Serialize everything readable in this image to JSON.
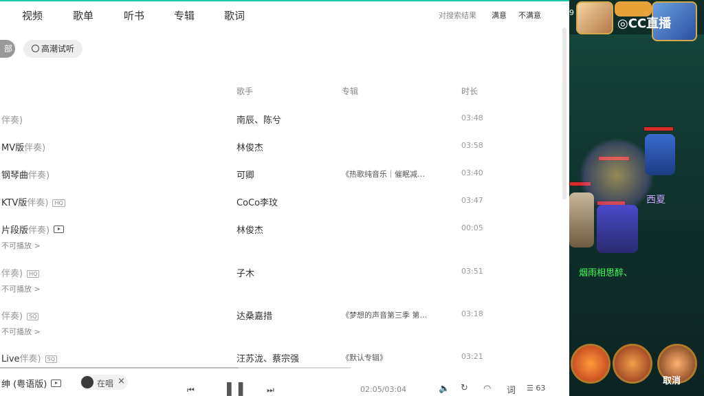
{
  "tabs": [
    "视频",
    "歌单",
    "听书",
    "专辑",
    "歌词"
  ],
  "feedback": {
    "question": "对搜索结果",
    "satisfied": "满意",
    "unsatisfied": "不满意"
  },
  "filters": {
    "all_partial": "部",
    "highlight": "高潮试听"
  },
  "columns": {
    "artist": "歌手",
    "album": "专辑",
    "duration": "时长"
  },
  "rows": [
    {
      "title": "",
      "title_acc": "伴奏)",
      "badge": "",
      "mv": false,
      "sub": "",
      "artist": "南辰、陈兮",
      "album": "",
      "duration": "03:48"
    },
    {
      "title": "MV版",
      "title_acc": "伴奏)",
      "badge": "",
      "mv": false,
      "sub": "",
      "artist": "林俊杰",
      "album": "",
      "duration": "03:58"
    },
    {
      "title": "钢琴曲",
      "title_acc": "伴奏)",
      "badge": "",
      "mv": false,
      "sub": "",
      "artist": "可卿",
      "album": "《热歌纯音乐｜催眠减…",
      "duration": "03:40"
    },
    {
      "title": "KTV版",
      "title_acc": "伴奏)",
      "badge": "HQ",
      "mv": false,
      "sub": "",
      "artist": "CoCo李玟",
      "album": "",
      "duration": "03:47"
    },
    {
      "title": "片段版",
      "title_acc": "伴奏)",
      "badge": "",
      "mv": true,
      "sub": "不可播放 >",
      "artist": "林俊杰",
      "album": "",
      "duration": "00:05"
    },
    {
      "title": "",
      "title_acc": "伴奏)",
      "badge": "HQ",
      "mv": false,
      "sub": "不可播放 >",
      "artist": "子木",
      "album": "",
      "duration": "03:51"
    },
    {
      "title": "",
      "title_acc": "伴奏)",
      "badge": "SQ",
      "mv": false,
      "sub": "不可播放 >",
      "artist": "达桑嘉措",
      "album": "《梦想的声音第三季 第…",
      "duration": "03:18"
    },
    {
      "title": "Live",
      "title_acc": "伴奏)",
      "badge": "SQ",
      "mv": false,
      "sub": "",
      "artist": "汪苏泷、蔡宗强",
      "album": "《默认专辑》",
      "duration": "03:21"
    }
  ],
  "player": {
    "title": "绅 (粤语版)",
    "singing_label": "在唱",
    "time": "02:05/03:04",
    "lyrics_btn": "词",
    "playlist_count": "63",
    "progress_fraction": 0.68
  },
  "game": {
    "brand": "CC直播",
    "player_name": "烟雨相思醉、",
    "level_digit": "9",
    "cancel": "取消",
    "float_text": "西夏",
    "colors": {
      "hp": "#d92a2a",
      "name": "#3cff5a"
    }
  },
  "accent": "#1cc9a6"
}
